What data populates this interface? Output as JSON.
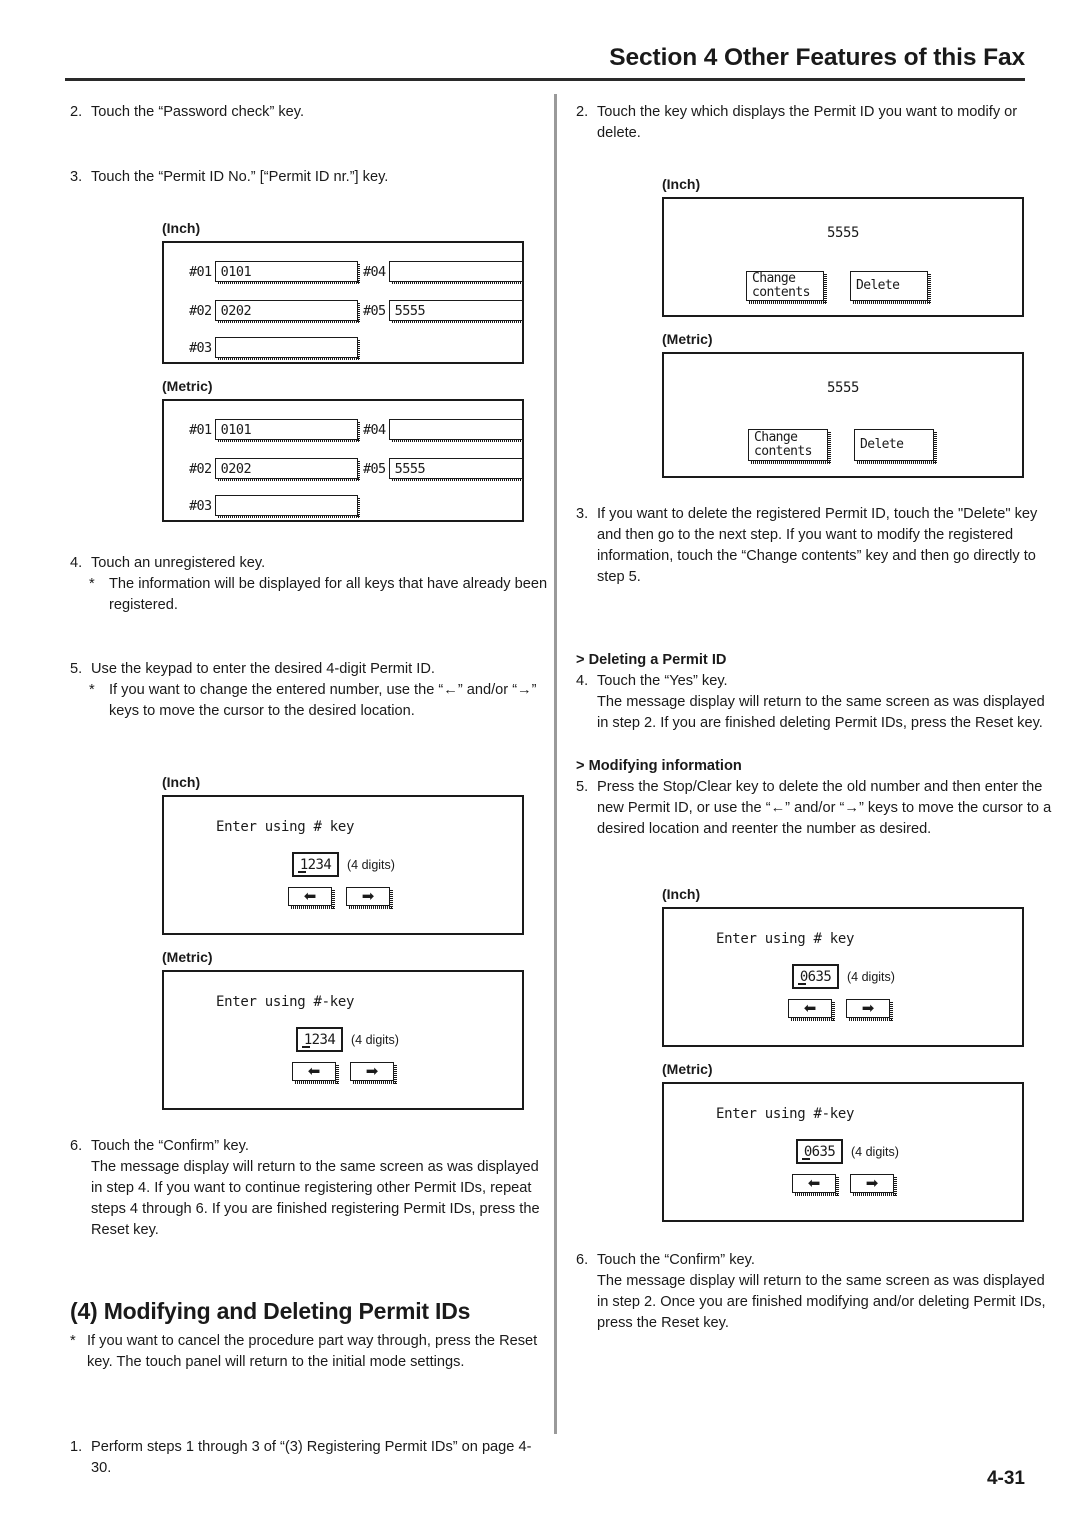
{
  "header": {
    "section_title": "Section 4 Other Features of this Fax"
  },
  "page_number": "4-31",
  "labels": {
    "inch": "(Inch)",
    "metric": "(Metric)",
    "digits_note": "(4 digits)",
    "arrow_left": "←",
    "arrow_right": "→"
  },
  "left_column": {
    "step2": {
      "num": "2.",
      "text": "Touch the “Password check” key."
    },
    "step3": {
      "num": "3.",
      "text": "Touch the “Permit ID No.” [“Permit ID nr.”] key."
    },
    "permit_list_screen": {
      "keys": [
        {
          "label": "#01",
          "value": "0101"
        },
        {
          "label": "#02",
          "value": "0202"
        },
        {
          "label": "#03",
          "value": ""
        },
        {
          "label": "#04",
          "value": ""
        },
        {
          "label": "#05",
          "value": "5555"
        }
      ]
    },
    "step4": {
      "num": "4.",
      "text": "Touch an unregistered key.",
      "note_star": "*",
      "note": "The information will be displayed for all keys that have already been registered."
    },
    "step5": {
      "num": "5.",
      "text": "Use the keypad to enter the desired 4-digit Permit ID.",
      "note_star": "*",
      "note": "If you want to change the entered number, use the “←” and/or “→” keys to move the cursor to the desired location."
    },
    "entry_screen": {
      "prompt_inch": "Enter using # key",
      "prompt_metric": "Enter using #-key",
      "value": "1234"
    },
    "step6": {
      "num": "6.",
      "text": "Touch the “Confirm” key.",
      "body": "The message display will return to the same screen as was displayed in step 4. If you want to continue registering other Permit IDs, repeat steps 4 through 6. If you are finished registering Permit IDs, press the Reset key."
    },
    "section_heading": "(4) Modifying and Deleting Permit IDs",
    "section_note_star": "*",
    "section_note": "If you want to cancel the procedure part way through, press the Reset key. The touch panel will return to the initial mode settings.",
    "step1": {
      "num": "1.",
      "text": "Perform steps 1 through 3 of “(3) Registering Permit IDs” on page 4-30."
    }
  },
  "right_column": {
    "step2": {
      "num": "2.",
      "text": "Touch the key which displays the Permit ID you want to modify or delete."
    },
    "modify_screen": {
      "permit_id": "5555",
      "change_contents_line1": "Change",
      "change_contents_line2": "contents",
      "delete_label": "Delete"
    },
    "step3": {
      "num": "3.",
      "text": "If you want to delete the registered Permit ID, touch the \"Delete\" key and then go to the next step. If you want to modify the registered information, touch the “Change contents” key and then go directly to step 5."
    },
    "deleting_heading": "> Deleting a Permit ID",
    "step4": {
      "num": "4.",
      "text": "Touch the “Yes” key.",
      "body": "The message display will return to the same screen as was displayed in step 2. If you are finished deleting Permit IDs, press the Reset key."
    },
    "modifying_heading": "> Modifying information",
    "step5": {
      "num": "5.",
      "text": "Press the Stop/Clear key to delete the old number and then enter the new Permit ID, or use the “←” and/or “→” keys to move the cursor to a desired location and reenter the number as desired."
    },
    "entry_screen": {
      "prompt_inch": "Enter using # key",
      "prompt_metric": "Enter using #-key",
      "value": "0635"
    },
    "step6": {
      "num": "6.",
      "text": "Touch the “Confirm” key.",
      "body": "The message display will return to the same screen as was displayed in step 2. Once you are finished modifying and/or deleting Permit IDs, press the Reset key."
    }
  }
}
